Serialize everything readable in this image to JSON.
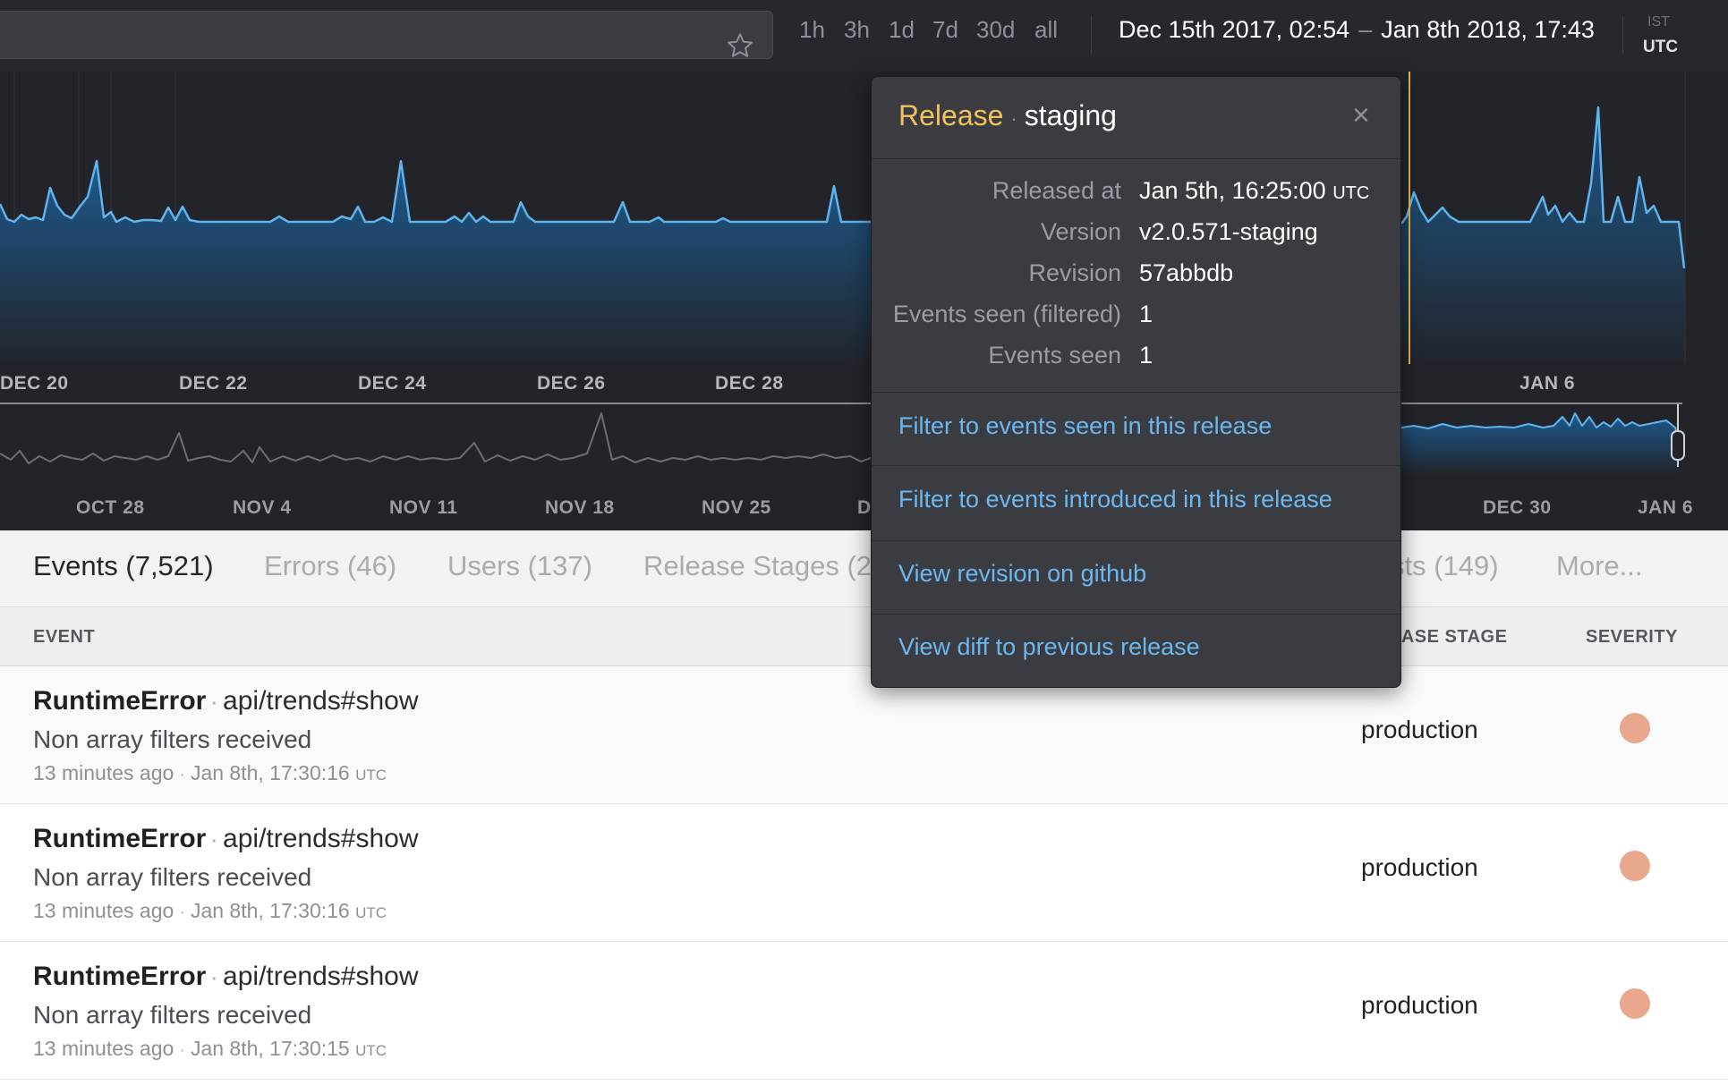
{
  "topbar": {
    "ranges": [
      "1h",
      "3h",
      "1d",
      "7d",
      "30d",
      "all"
    ],
    "date_from": "Dec 15th 2017, 02:54",
    "date_sep": "–",
    "date_to": "Jan 8th 2018, 17:43",
    "tz_secondary": "IST",
    "tz_primary": "UTC",
    "icon": "star-icon"
  },
  "chart": {
    "date_labels": [
      "DEC 20",
      "DEC 22",
      "DEC 24",
      "DEC 26",
      "DEC 28",
      "JAN 6"
    ],
    "overview_labels": [
      "OCT 28",
      "NOV 4",
      "NOV 11",
      "NOV 18",
      "NOV 25",
      "D",
      "DEC 30",
      "JAN 6"
    ],
    "line_color": "#5fb4ee",
    "release_marker_color": "#e8b54a"
  },
  "tabs": [
    {
      "label": "Events (7,521)",
      "active": true
    },
    {
      "label": "Errors (46)",
      "active": false
    },
    {
      "label": "Users (137)",
      "active": false
    },
    {
      "label": "Release Stages (2)",
      "active": false
    },
    {
      "label": "sts (149)",
      "active": false
    },
    {
      "label": "More...",
      "active": false
    }
  ],
  "table": {
    "col_event": "EVENT",
    "col_stage": "EASE STAGE",
    "col_severity": "SEVERITY",
    "rows": [
      {
        "error_class": "RuntimeError",
        "context": "api/trends#show",
        "message": "Non array filters received",
        "ago": "13 minutes ago",
        "timestamp": "Jan 8th, 17:30:16",
        "tz": "UTC",
        "stage": "production",
        "severity_color": "#e9a88d"
      },
      {
        "error_class": "RuntimeError",
        "context": "api/trends#show",
        "message": "Non array filters received",
        "ago": "13 minutes ago",
        "timestamp": "Jan 8th, 17:30:16",
        "tz": "UTC",
        "stage": "production",
        "severity_color": "#e9a88d"
      },
      {
        "error_class": "RuntimeError",
        "context": "api/trends#show",
        "message": "Non array filters received",
        "ago": "13 minutes ago",
        "timestamp": "Jan 8th, 17:30:15",
        "tz": "UTC",
        "stage": "production",
        "severity_color": "#e9a88d"
      }
    ]
  },
  "popover": {
    "kind": "Release",
    "stage": "staging",
    "close": "×",
    "details": [
      {
        "key": "Released at",
        "value": "Jan 5th, 16:25:00",
        "suffix": "UTC"
      },
      {
        "key": "Version",
        "value": "v2.0.571-staging"
      },
      {
        "key": "Revision",
        "value": "57abbdb"
      },
      {
        "key": "Events seen (filtered)",
        "value": "1"
      },
      {
        "key": "Events seen",
        "value": "1"
      }
    ],
    "links": [
      "Filter to events seen in this release",
      "Filter to events introduced in this release",
      "View revision on github",
      "View diff to previous release"
    ],
    "accent_color": "#f4c25b",
    "link_color": "#6cb8ee"
  }
}
